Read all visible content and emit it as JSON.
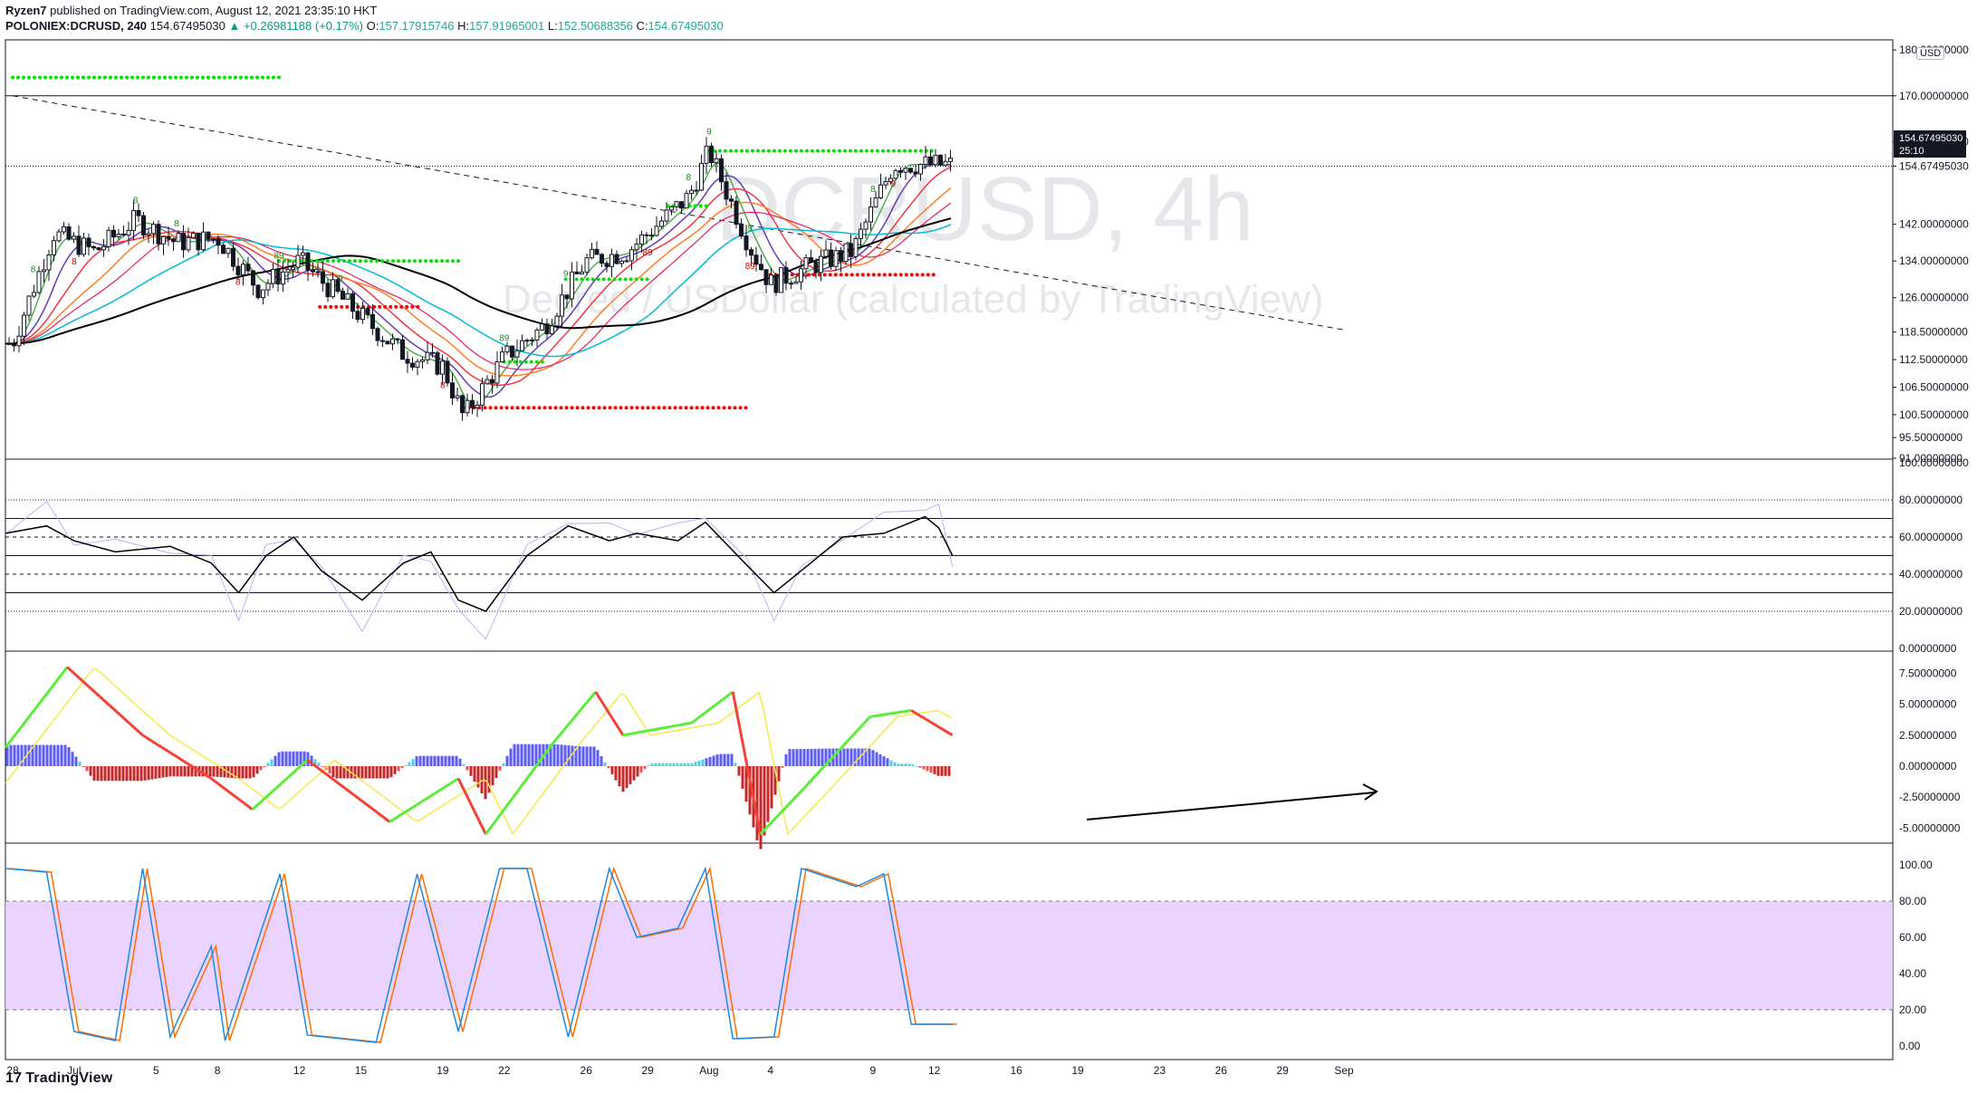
{
  "header": {
    "publisher": "Ryzen7",
    "published_text": "published on TradingView.com, August 12, 2021 23:35:10 HKT",
    "symbol": "POLONIEX:DCRUSD, 240",
    "last": "154.67495030",
    "change": "+0.26981188 (+0.17%)",
    "o_label": "O:",
    "o": "157.17915746",
    "h_label": "H:",
    "h": "157.91965001",
    "l_label": "L:",
    "l": "152.50688356",
    "c_label": "C:",
    "c": "154.67495030"
  },
  "watermark": {
    "title": "DCRUSD, 4h",
    "subtitle": "Decred / USDollar (calculated by TradingView)"
  },
  "brand": {
    "text": "TradingView",
    "logo": "17"
  },
  "currency_badge": "USD",
  "price_tag": {
    "price": "154.67495030",
    "timer": "25:10"
  },
  "colors": {
    "price_tag_bg": "#131722",
    "up_candle": "#131722",
    "grid_line": "#131722",
    "sma_black": "#000000",
    "ema_green": "#4caf50",
    "ema_purple": "#673ab7",
    "ema_red": "#f23645",
    "ema_orange": "#ff7f27",
    "ema_pink": "#e91e63",
    "ema_teal": "#00bcd4",
    "dot_green": "#00e600",
    "dot_red": "#ff0000",
    "stoch_band": "#e6ccff",
    "stoch_k": "#1e88e5",
    "stoch_d": "#ff6d00"
  },
  "chart_data": [
    {
      "type": "candlestick",
      "title": "DCRUSD, 4h",
      "pane": "price",
      "y_ticks": [
        "180.00000000",
        "170.00000000",
        "160.00000000",
        "154.67495030",
        "142.00000000",
        "134.00000000",
        "126.00000000",
        "118.50000000",
        "112.50000000",
        "106.50000000",
        "100.50000000",
        "95.50000000",
        "91.00000000"
      ],
      "ylim": [
        91,
        182
      ],
      "x_tick_labels": [
        "28",
        "Jul",
        "5",
        "8",
        "12",
        "15",
        "19",
        "22",
        "26",
        "29",
        "Aug",
        "4",
        "9",
        "12",
        "16",
        "19",
        "23",
        "26",
        "29",
        "Sep"
      ],
      "close_path": [
        [
          "Jun 28",
          116
        ],
        [
          "Jun 30",
          140
        ],
        [
          "Jul 2",
          136
        ],
        [
          "Jul 4",
          143
        ],
        [
          "Jul 6",
          138
        ],
        [
          "Jul 8",
          139
        ],
        [
          "Jul 10",
          128
        ],
        [
          "Jul 12",
          134
        ],
        [
          "Jul 14",
          126
        ],
        [
          "Jul 17",
          114
        ],
        [
          "Jul 19",
          111
        ],
        [
          "Jul 20",
          100
        ],
        [
          "Jul 22",
          113
        ],
        [
          "Jul 24",
          120
        ],
        [
          "Jul 26",
          134
        ],
        [
          "Jul 28",
          136
        ],
        [
          "Jul 31",
          148
        ],
        [
          "Aug 1",
          158
        ],
        [
          "Aug 3",
          137
        ],
        [
          "Aug 4",
          129
        ],
        [
          "Aug 6",
          133
        ],
        [
          "Aug 8",
          136
        ],
        [
          "Aug 10",
          155
        ],
        [
          "Aug 12",
          155
        ]
      ],
      "horizontal_lines": [
        170,
        154.67
      ],
      "trendline": {
        "start": [
          "Jun 28",
          170
        ],
        "end": [
          "Sep 1",
          119
        ]
      },
      "td_labels": [
        "8",
        "8",
        "8",
        "8",
        "8",
        "89",
        "9",
        "8",
        "89",
        "9",
        "89",
        "8",
        "9",
        "89",
        "9",
        "8",
        "9"
      ],
      "dot_levels": [
        {
          "color": "#00e600",
          "y": 174,
          "from": "Jun 28",
          "to": "Jul 11"
        },
        {
          "color": "#00e600",
          "y": 134,
          "from": "Jul 11",
          "to": "Jul 20"
        },
        {
          "color": "#ff0000",
          "y": 124,
          "from": "Jul 13",
          "to": "Jul 18"
        },
        {
          "color": "#00e600",
          "y": 112,
          "from": "Jul 22",
          "to": "Jul 24"
        },
        {
          "color": "#ff0000",
          "y": 102,
          "from": "Jul 20",
          "to": "Aug 3"
        },
        {
          "color": "#00e600",
          "y": 130,
          "from": "Jul 25",
          "to": "Jul 29"
        },
        {
          "color": "#00e600",
          "y": 146,
          "from": "Jul 30",
          "to": "Aug 1"
        },
        {
          "color": "#00e600",
          "y": 158,
          "from": "Aug 1",
          "to": "Aug 12"
        },
        {
          "color": "#ff0000",
          "y": 131,
          "from": "Aug 4",
          "to": "Aug 12"
        }
      ]
    },
    {
      "type": "line",
      "pane": "rsi",
      "y_ticks": [
        "100.00000000",
        "80.00000000",
        "60.00000000",
        "40.00000000",
        "20.00000000",
        "0.00000000"
      ],
      "ylim": [
        0,
        100
      ],
      "levels": [
        80,
        70,
        60,
        50,
        40,
        30,
        20
      ],
      "series": [
        {
          "values": [
            [
              0,
              62
            ],
            [
              0.03,
              66
            ],
            [
              0.05,
              58
            ],
            [
              0.08,
              52
            ],
            [
              0.12,
              55
            ],
            [
              0.15,
              46
            ],
            [
              0.17,
              30
            ],
            [
              0.19,
              50
            ],
            [
              0.21,
              60
            ],
            [
              0.23,
              42
            ],
            [
              0.26,
              26
            ],
            [
              0.29,
              46
            ],
            [
              0.31,
              52
            ],
            [
              0.33,
              26
            ],
            [
              0.35,
              20
            ],
            [
              0.38,
              50
            ],
            [
              0.41,
              66
            ],
            [
              0.44,
              58
            ],
            [
              0.46,
              62
            ],
            [
              0.49,
              58
            ],
            [
              0.51,
              68
            ],
            [
              0.54,
              45
            ],
            [
              0.56,
              30
            ],
            [
              0.58,
              42
            ],
            [
              0.61,
              60
            ],
            [
              0.64,
              62
            ],
            [
              0.67,
              71
            ],
            [
              0.68,
              65
            ],
            [
              0.69,
              50
            ]
          ]
        }
      ]
    },
    {
      "type": "line",
      "pane": "macd",
      "y_ticks": [
        "7.50000000",
        "5.00000000",
        "2.50000000",
        "0.00000000",
        "-2.50000000",
        "-5.00000000"
      ],
      "ylim": [
        -6,
        9
      ],
      "series": [
        {
          "values": [
            [
              0,
              1.5
            ],
            [
              0.045,
              8
            ],
            [
              0.1,
              2.5
            ],
            [
              0.15,
              -1
            ],
            [
              0.18,
              -3.5
            ],
            [
              0.22,
              0.5
            ],
            [
              0.28,
              -4.5
            ],
            [
              0.33,
              -1
            ],
            [
              0.35,
              -5.5
            ],
            [
              0.4,
              2
            ],
            [
              0.43,
              6
            ],
            [
              0.45,
              2.5
            ],
            [
              0.5,
              3.5
            ],
            [
              0.53,
              6
            ],
            [
              0.55,
              -5.5
            ],
            [
              0.58,
              -2
            ],
            [
              0.63,
              4
            ],
            [
              0.66,
              4.5
            ],
            [
              0.69,
              2.5
            ]
          ]
        }
      ]
    },
    {
      "type": "line",
      "pane": "stochastic",
      "y_ticks": [
        "100.00",
        "80.00",
        "60.00",
        "40.00",
        "20.00",
        "0.00"
      ],
      "ylim": [
        0,
        100
      ],
      "band": [
        20,
        80
      ],
      "series": [
        {
          "values": [
            [
              0,
              98
            ],
            [
              0.03,
              96
            ],
            [
              0.05,
              8
            ],
            [
              0.08,
              3
            ],
            [
              0.1,
              98
            ],
            [
              0.12,
              5
            ],
            [
              0.15,
              55
            ],
            [
              0.16,
              3
            ],
            [
              0.2,
              95
            ],
            [
              0.22,
              6
            ],
            [
              0.27,
              2
            ],
            [
              0.3,
              95
            ],
            [
              0.33,
              8
            ],
            [
              0.36,
              98
            ],
            [
              0.38,
              98
            ],
            [
              0.41,
              5
            ],
            [
              0.44,
              98
            ],
            [
              0.46,
              60
            ],
            [
              0.49,
              65
            ],
            [
              0.51,
              98
            ],
            [
              0.53,
              4
            ],
            [
              0.56,
              5
            ],
            [
              0.58,
              98
            ],
            [
              0.62,
              88
            ],
            [
              0.64,
              95
            ],
            [
              0.66,
              12
            ],
            [
              0.69,
              12
            ]
          ]
        }
      ]
    }
  ]
}
